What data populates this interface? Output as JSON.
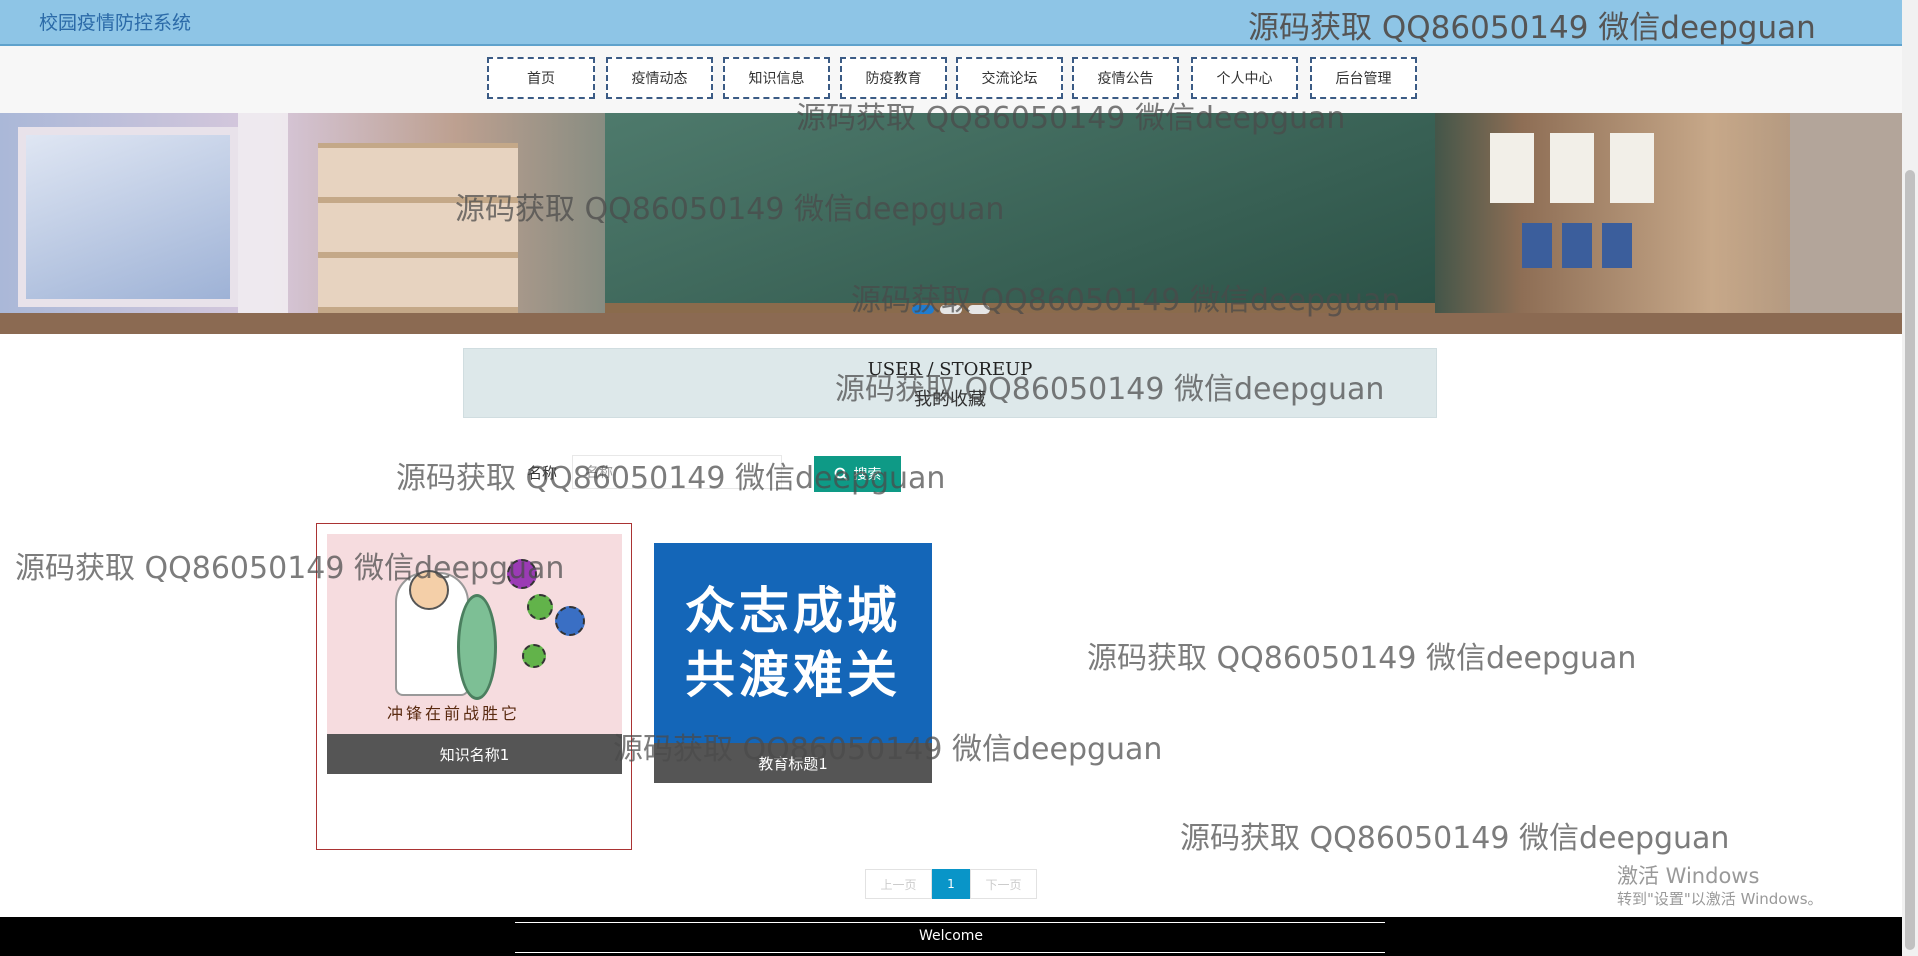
{
  "header": {
    "site_title": "校园疫情防控系统",
    "watermark": "源码获取 QQ86050149 微信deepguan"
  },
  "nav": {
    "items": [
      {
        "label": "首页"
      },
      {
        "label": "疫情动态"
      },
      {
        "label": "知识信息"
      },
      {
        "label": "防疫教育"
      },
      {
        "label": "交流论坛"
      },
      {
        "label": "疫情公告"
      },
      {
        "label": "个人中心"
      },
      {
        "label": "后台管理"
      }
    ]
  },
  "banner": {
    "slide_count": 3,
    "active_slide": 1
  },
  "page_title": {
    "en": "USER / STOREUP",
    "cn": "我的收藏"
  },
  "search": {
    "label": "名称",
    "placeholder": "名称",
    "button_label": "搜索",
    "button_icon": "search-icon"
  },
  "cards": [
    {
      "caption": "知识名称1",
      "image_text": "冲锋在前战胜它"
    },
    {
      "caption": "教育标题1",
      "image_text_line1": "众志成城",
      "image_text_line2": "共渡难关"
    }
  ],
  "pagination": {
    "prev": "上一页",
    "current": "1",
    "next": "下一页"
  },
  "footer": {
    "text": "Welcome"
  },
  "watermarks": {
    "text": "源码获取 QQ86050149 微信deepguan"
  },
  "os_overlay": {
    "title": "激活 Windows",
    "subtitle": "转到\"设置\"以激活 Windows。"
  },
  "colors": {
    "topbar": "#8ec5e6",
    "search_button": "#0e9a86",
    "pagination_active": "#0995c8",
    "footer": "#000000"
  }
}
